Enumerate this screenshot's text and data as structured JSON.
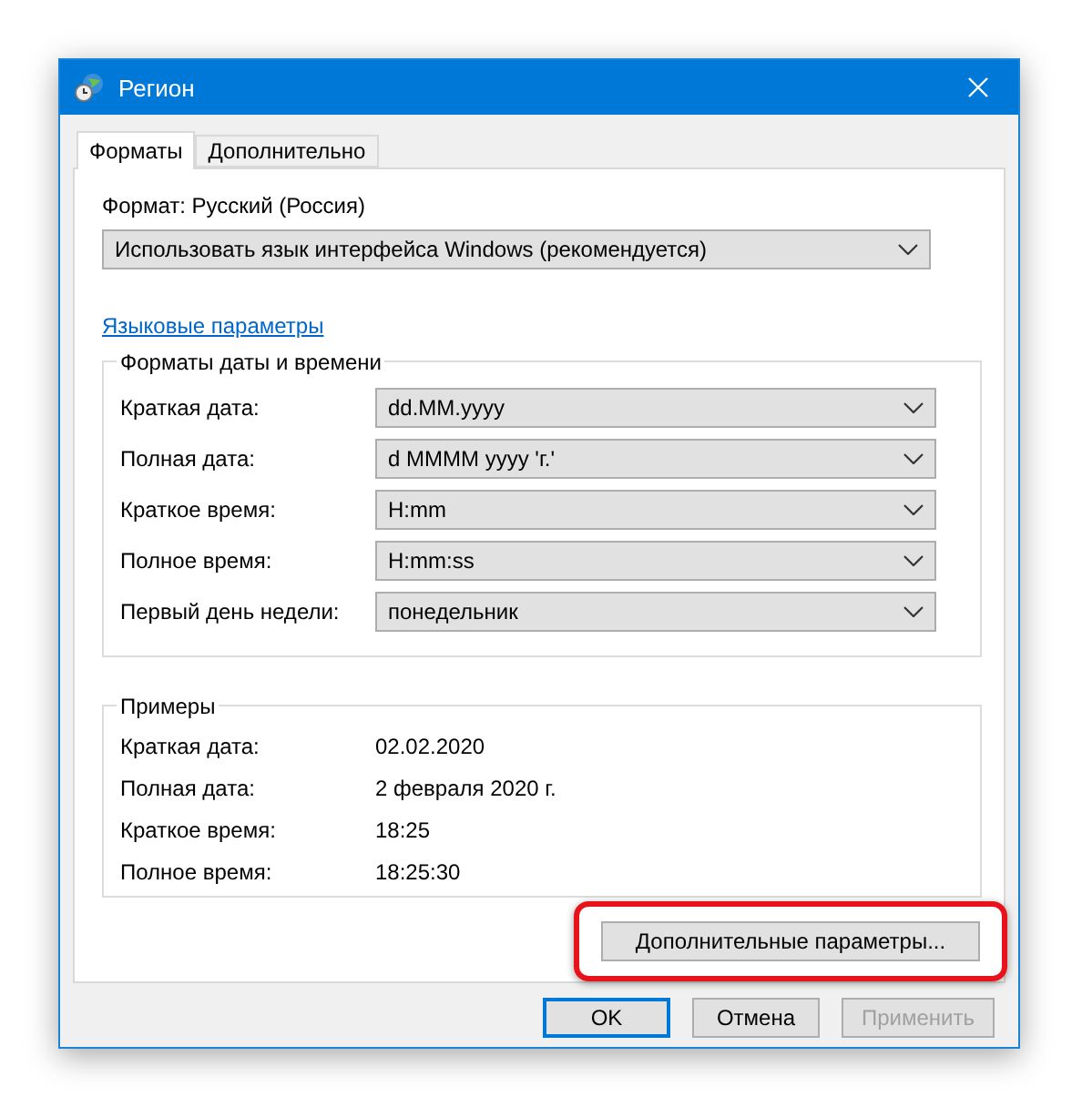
{
  "window": {
    "title": "Регион"
  },
  "tabs": [
    {
      "label": "Форматы",
      "selected": true
    },
    {
      "label": "Дополнительно",
      "selected": false
    }
  ],
  "format": {
    "label": "Формат: Русский (Россия)",
    "value": "Использовать язык интерфейса Windows (рекомендуется)"
  },
  "language_link": "Языковые параметры",
  "formats_group": {
    "title": "Форматы даты и времени",
    "rows": [
      {
        "label": "Краткая дата:",
        "value": "dd.MM.yyyy"
      },
      {
        "label": "Полная дата:",
        "value": "d MMMM yyyy 'г.'"
      },
      {
        "label": "Краткое время:",
        "value": "H:mm"
      },
      {
        "label": "Полное время:",
        "value": "H:mm:ss"
      },
      {
        "label": "Первый день недели:",
        "value": "понедельник"
      }
    ]
  },
  "examples_group": {
    "title": "Примеры",
    "rows": [
      {
        "label": "Краткая дата:",
        "value": "02.02.2020"
      },
      {
        "label": "Полная дата:",
        "value": "2 февраля 2020 г."
      },
      {
        "label": "Краткое время:",
        "value": "18:25"
      },
      {
        "label": "Полное время:",
        "value": "18:25:30"
      }
    ]
  },
  "advanced_button": {
    "label": "Дополнительные параметры...",
    "highlighted": true
  },
  "buttons": [
    {
      "label": "OK",
      "kind": "default",
      "disabled": false
    },
    {
      "label": "Отмена",
      "kind": "normal",
      "disabled": false
    },
    {
      "label": "Применить",
      "kind": "normal",
      "disabled": true
    }
  ]
}
